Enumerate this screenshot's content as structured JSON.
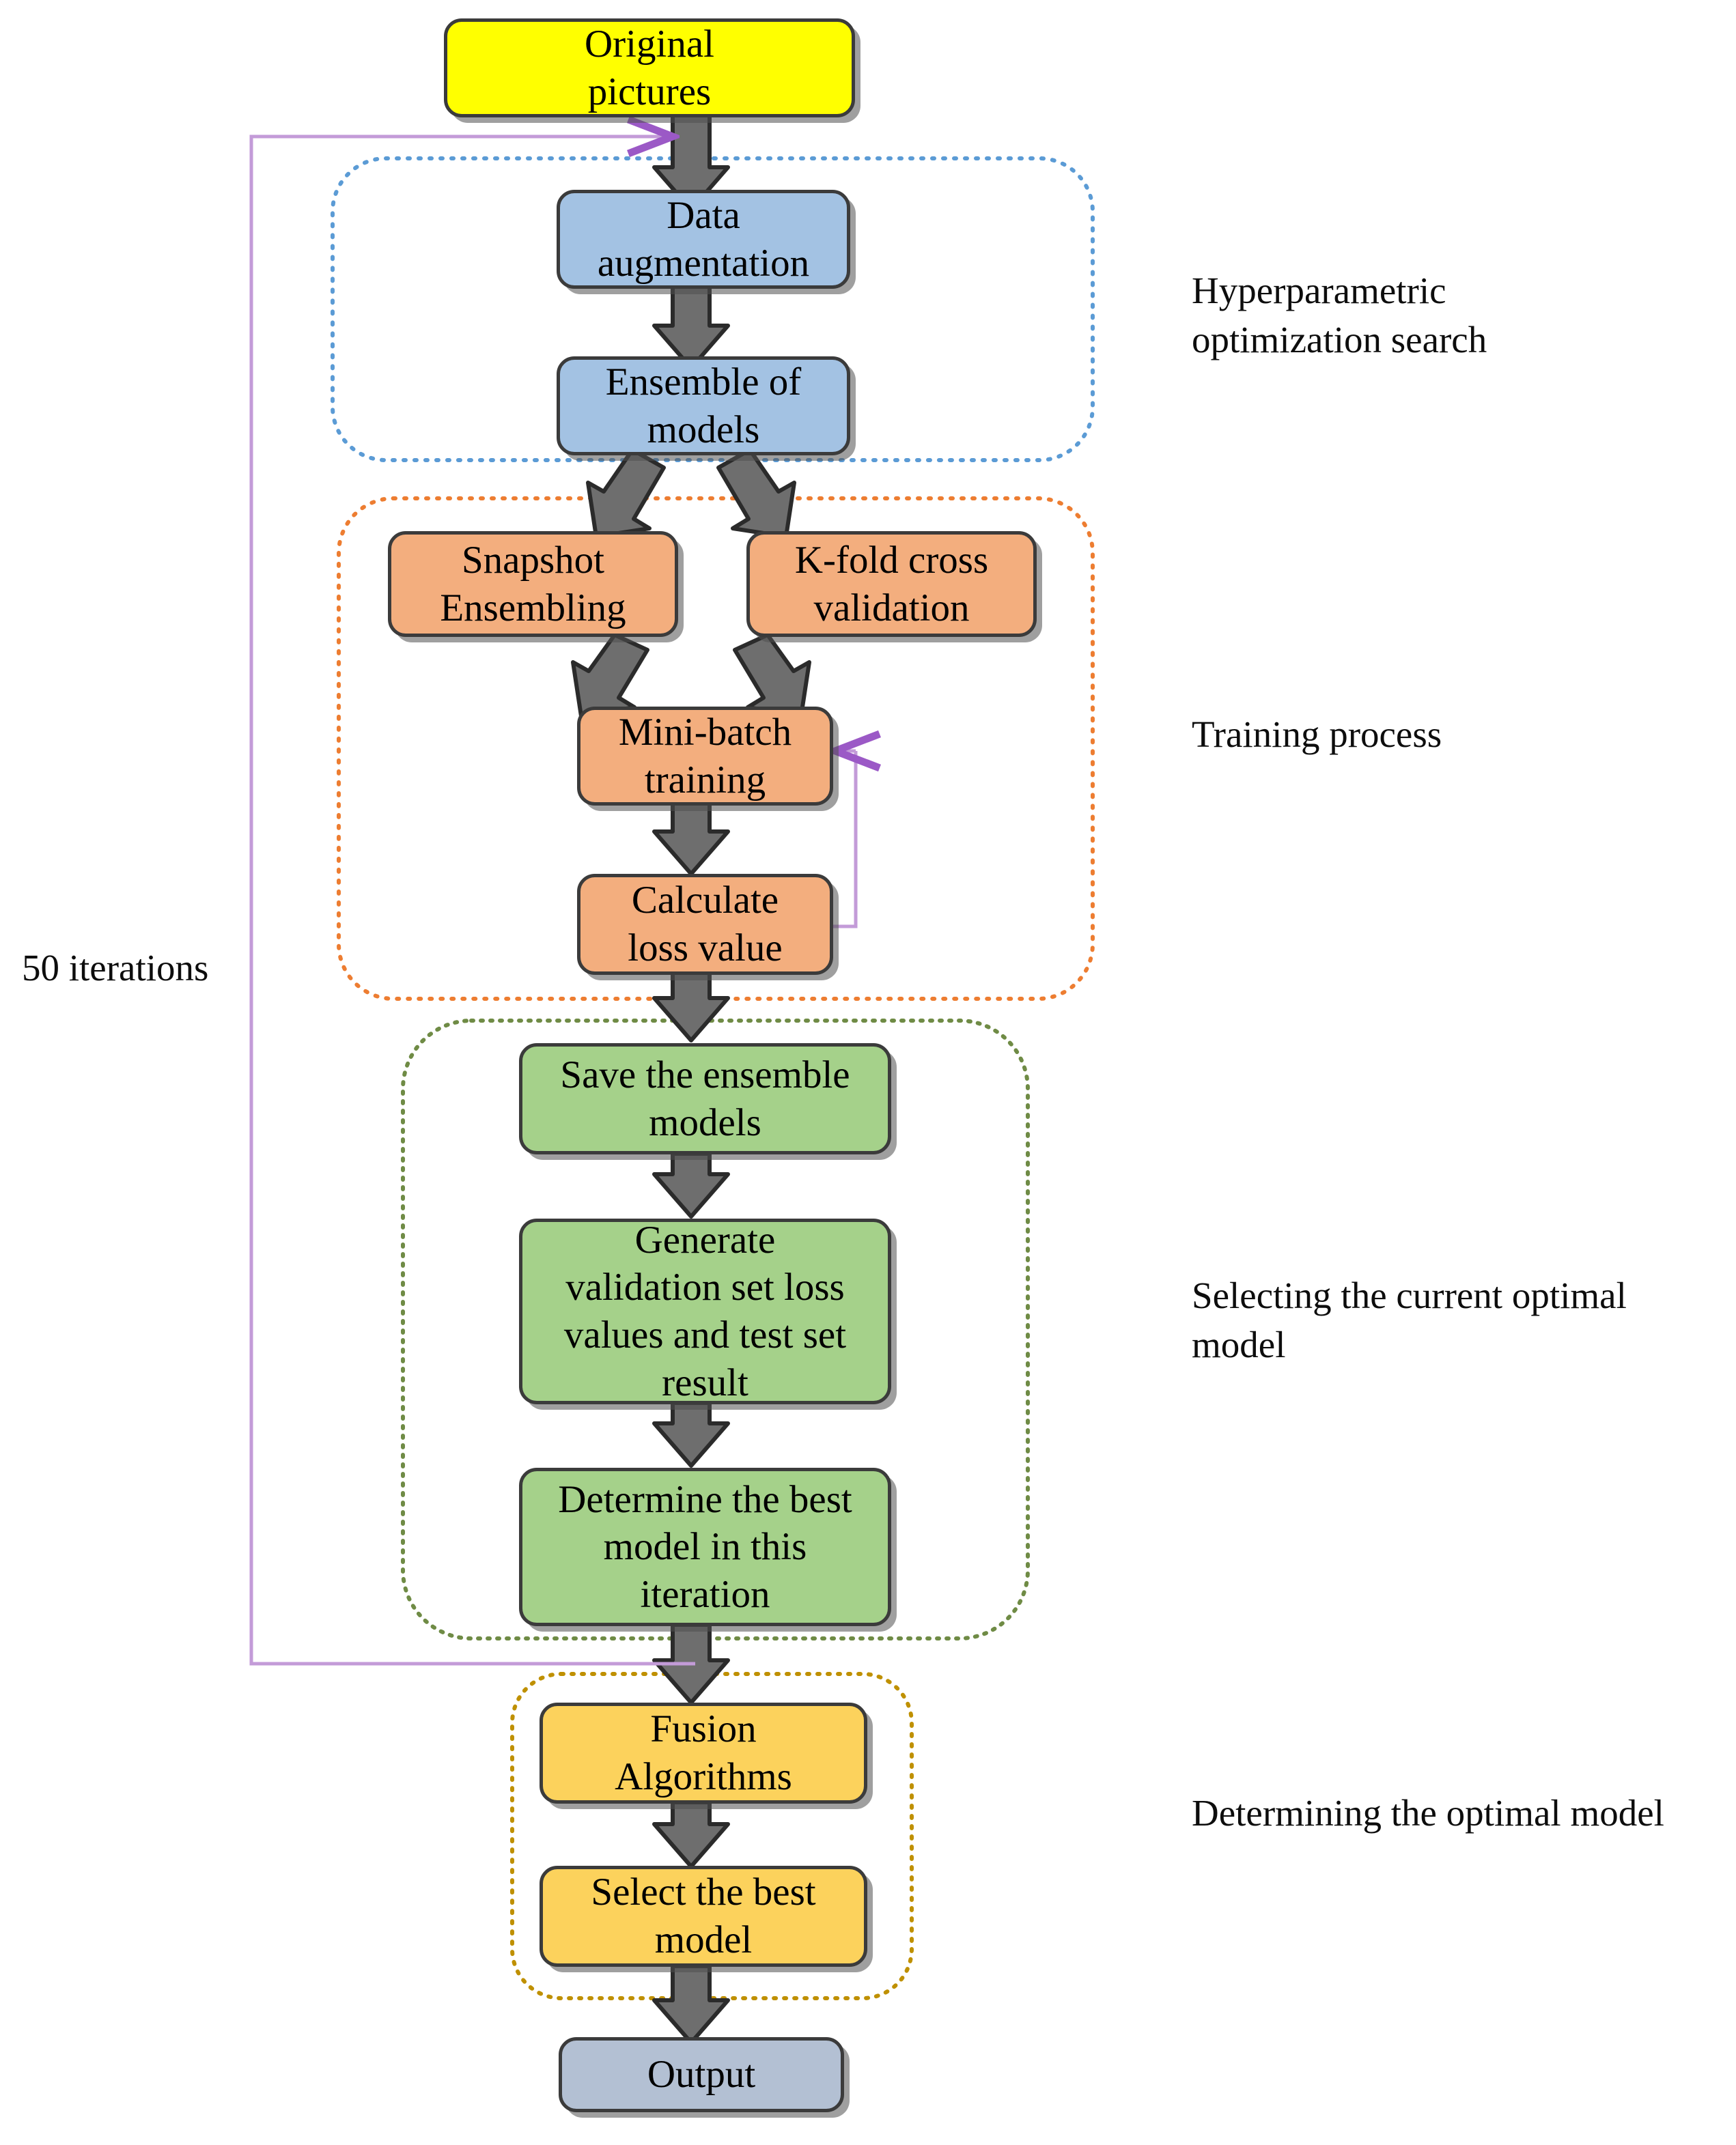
{
  "diagram": {
    "title": "Deep learning ensemble model training and selection flowchart",
    "colors": {
      "start_node": "#ffff00",
      "augment_node": "#a3c2e3",
      "training_node": "#f3ae7e",
      "selection_node": "#a5d18a",
      "fusion_node": "#fcd25c",
      "output_node": "#b3c0d3",
      "arrow_gray": "#6e6e6e",
      "arrow_outline": "#2b2b2b",
      "loop_purple": "#c39bd8",
      "group_blue": "#5b9bd5",
      "group_orange": "#ed7d31",
      "group_green": "#70893f",
      "group_gold": "#bf9000"
    },
    "nodes": [
      {
        "id": "original_pictures",
        "label_lines": [
          "Original",
          "pictures"
        ],
        "color_key": "start_node"
      },
      {
        "id": "data_augmentation",
        "label_lines": [
          "Data",
          "augmentation"
        ],
        "color_key": "augment_node"
      },
      {
        "id": "ensemble_of_models",
        "label_lines": [
          "Ensemble of",
          "models"
        ],
        "color_key": "augment_node"
      },
      {
        "id": "snapshot_ensembling",
        "label_lines": [
          "Snapshot",
          "Ensembling"
        ],
        "color_key": "training_node"
      },
      {
        "id": "kfold_cross_validation",
        "label_lines": [
          "K-fold cross",
          "validation"
        ],
        "color_key": "training_node"
      },
      {
        "id": "mini_batch_training",
        "label_lines": [
          "Mini-batch",
          "training"
        ],
        "color_key": "training_node"
      },
      {
        "id": "calculate_loss_value",
        "label_lines": [
          "Calculate",
          "loss value"
        ],
        "color_key": "training_node"
      },
      {
        "id": "save_ensemble_models",
        "label_lines": [
          "Save the ensemble",
          "models"
        ],
        "color_key": "selection_node"
      },
      {
        "id": "generate_validation_results",
        "label_lines": [
          "Generate",
          "validation set loss",
          "values and test set",
          "result"
        ],
        "color_key": "selection_node"
      },
      {
        "id": "determine_best_model_iteration",
        "label_lines": [
          "Determine the best",
          "model in this",
          "iteration"
        ],
        "color_key": "selection_node"
      },
      {
        "id": "fusion_algorithms",
        "label_lines": [
          "Fusion",
          "Algorithms"
        ],
        "color_key": "fusion_node"
      },
      {
        "id": "select_best_model",
        "label_lines": [
          "Select the best",
          "model"
        ],
        "color_key": "fusion_node"
      },
      {
        "id": "output",
        "label_lines": [
          "Output"
        ],
        "color_key": "output_node"
      }
    ],
    "stage_labels": [
      {
        "id": "hyperparametric",
        "lines": [
          "Hyperparametric",
          "optimization search"
        ]
      },
      {
        "id": "training_process",
        "lines": [
          "Training process"
        ]
      },
      {
        "id": "selecting_current_optimal",
        "lines": [
          "Selecting the current optimal",
          "model"
        ]
      },
      {
        "id": "determining_optimal",
        "lines": [
          "Determining the optimal model"
        ]
      }
    ],
    "loop_label": {
      "id": "iterations",
      "text": "50 iterations"
    },
    "groups": [
      {
        "id": "hyperparametric-group",
        "color_key": "group_blue"
      },
      {
        "id": "training-group",
        "color_key": "group_orange"
      },
      {
        "id": "selection-group",
        "color_key": "group_green"
      },
      {
        "id": "fusion-group",
        "color_key": "group_gold"
      }
    ],
    "edges": [
      {
        "id": "original-to-augmentation",
        "from": "original_pictures",
        "to": "data_augmentation",
        "style": "block-arrow"
      },
      {
        "id": "augmentation-to-ensemble",
        "from": "data_augmentation",
        "to": "ensemble_of_models",
        "style": "block-arrow"
      },
      {
        "id": "ensemble-to-snapshot",
        "from": "ensemble_of_models",
        "to": "snapshot_ensembling",
        "style": "block-arrow"
      },
      {
        "id": "ensemble-to-kfold",
        "from": "ensemble_of_models",
        "to": "kfold_cross_validation",
        "style": "block-arrow"
      },
      {
        "id": "snapshot-to-minibatch",
        "from": "snapshot_ensembling",
        "to": "mini_batch_training",
        "style": "block-arrow"
      },
      {
        "id": "kfold-to-minibatch",
        "from": "kfold_cross_validation",
        "to": "mini_batch_training",
        "style": "block-arrow"
      },
      {
        "id": "minibatch-to-loss",
        "from": "mini_batch_training",
        "to": "calculate_loss_value",
        "style": "block-arrow"
      },
      {
        "id": "loss-to-minibatch-loop",
        "from": "calculate_loss_value",
        "to": "mini_batch_training",
        "style": "thin-purple-loop"
      },
      {
        "id": "loss-to-save",
        "from": "calculate_loss_value",
        "to": "save_ensemble_models",
        "style": "block-arrow"
      },
      {
        "id": "save-to-generate",
        "from": "save_ensemble_models",
        "to": "generate_validation_results",
        "style": "block-arrow"
      },
      {
        "id": "generate-to-determine",
        "from": "generate_validation_results",
        "to": "determine_best_model_iteration",
        "style": "block-arrow"
      },
      {
        "id": "determine-to-fusion",
        "from": "determine_best_model_iteration",
        "to": "fusion_algorithms",
        "style": "block-arrow"
      },
      {
        "id": "fusion-to-select",
        "from": "fusion_algorithms",
        "to": "select_best_model",
        "style": "block-arrow"
      },
      {
        "id": "select-to-output",
        "from": "select_best_model",
        "to": "output",
        "style": "block-arrow"
      },
      {
        "id": "iteration-feedback-loop",
        "from": "determine_best_model_iteration",
        "to": "data_augmentation",
        "style": "thin-purple-loop"
      }
    ]
  }
}
